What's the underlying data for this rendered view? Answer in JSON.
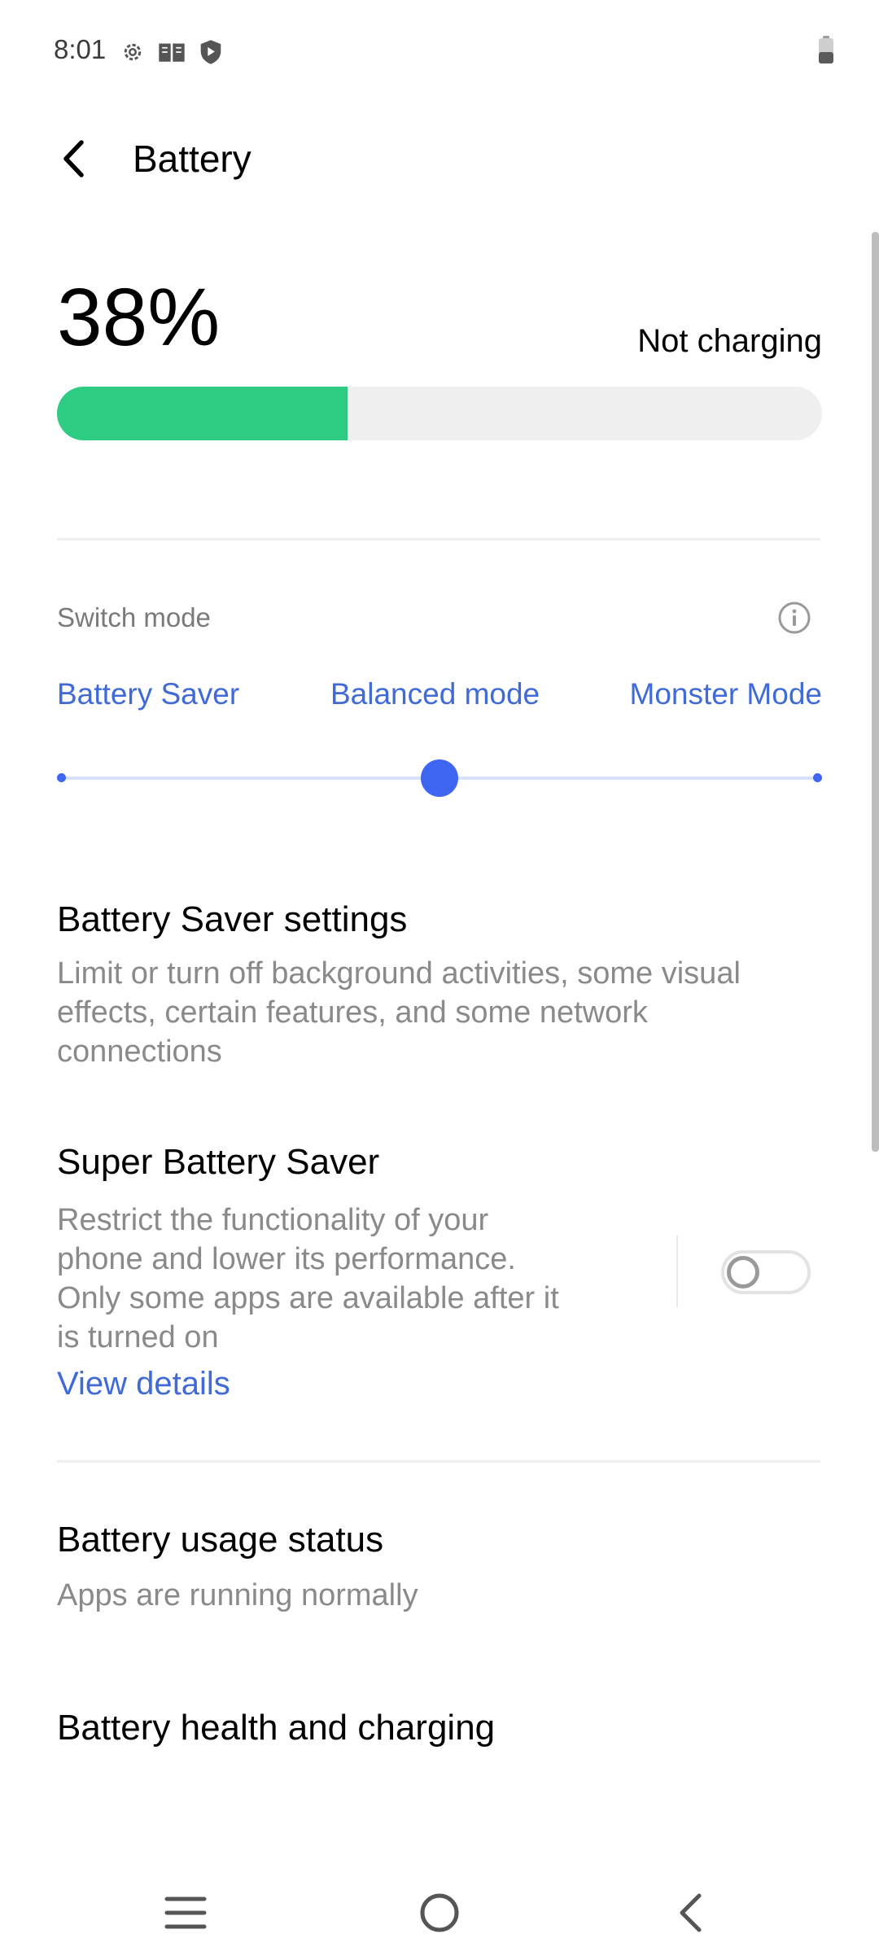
{
  "status_bar": {
    "time": "8:01",
    "icons": [
      "settings-gear-icon",
      "book-icon",
      "shield-play-icon"
    ],
    "battery_icon": "battery-low-icon"
  },
  "header": {
    "title": "Battery",
    "back_icon": "chevron-left-icon"
  },
  "battery": {
    "level_text": "38%",
    "level_fraction": 0.38,
    "charging_status": "Not charging",
    "fill_color": "#2dcc82"
  },
  "switch_mode": {
    "label": "Switch mode",
    "info_icon": "info-icon",
    "modes": [
      "Battery Saver",
      "Balanced mode",
      "Monster Mode"
    ],
    "selected_index": 1,
    "accent_color": "#3e66f0"
  },
  "battery_saver_settings": {
    "title": "Battery Saver settings",
    "description_lines": [
      "Limit or turn off background activities, some visual",
      "effects, certain features, and some network",
      "connections"
    ]
  },
  "super_battery_saver": {
    "title": "Super Battery Saver",
    "description_lines": [
      "Restrict the functionality of your",
      "phone and lower its performance.",
      "Only some apps are available after it",
      "is turned on"
    ],
    "link": "View details",
    "toggle_on": false
  },
  "battery_usage_status": {
    "title": "Battery usage status",
    "subtitle": "Apps are running normally"
  },
  "battery_health": {
    "title": "Battery health and charging"
  },
  "nav_bar": {
    "icons": [
      "menu-icon",
      "home-icon",
      "back-icon"
    ]
  }
}
